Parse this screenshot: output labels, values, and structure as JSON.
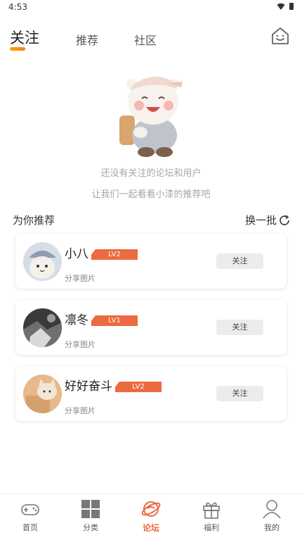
{
  "status": {
    "time": "4:53"
  },
  "tabs": [
    {
      "label": "关注",
      "active": true
    },
    {
      "label": "推荐",
      "active": false
    },
    {
      "label": "社区",
      "active": false
    }
  ],
  "empty_state": {
    "line1": "还没有关注的论坛和用户",
    "line2": "让我们一起看看小漆的推荐吧"
  },
  "recommend": {
    "title": "为你推荐",
    "refresh_label": "换一批"
  },
  "users": [
    {
      "name": "小八",
      "level": "LV2",
      "subtitle": "分享图片",
      "follow_label": "关注",
      "avatar": "cat-hat-avatar"
    },
    {
      "name": "凛冬",
      "level": "LV1",
      "subtitle": "分享图片",
      "follow_label": "关注",
      "avatar": "dark-photo-avatar"
    },
    {
      "name": "好好奋斗",
      "level": "LV2",
      "subtitle": "分享图片",
      "follow_label": "关注",
      "avatar": "kitten-box-avatar"
    }
  ],
  "nav": [
    {
      "label": "首页",
      "icon": "gamepad-icon",
      "active": false
    },
    {
      "label": "分类",
      "icon": "grid-icon",
      "active": false
    },
    {
      "label": "论坛",
      "icon": "planet-icon",
      "active": true
    },
    {
      "label": "福利",
      "icon": "gift-icon",
      "active": false
    },
    {
      "label": "我的",
      "icon": "user-icon",
      "active": false
    }
  ],
  "colors": {
    "accent": "#ec6a3f",
    "tab_underline": "#f6a400"
  }
}
